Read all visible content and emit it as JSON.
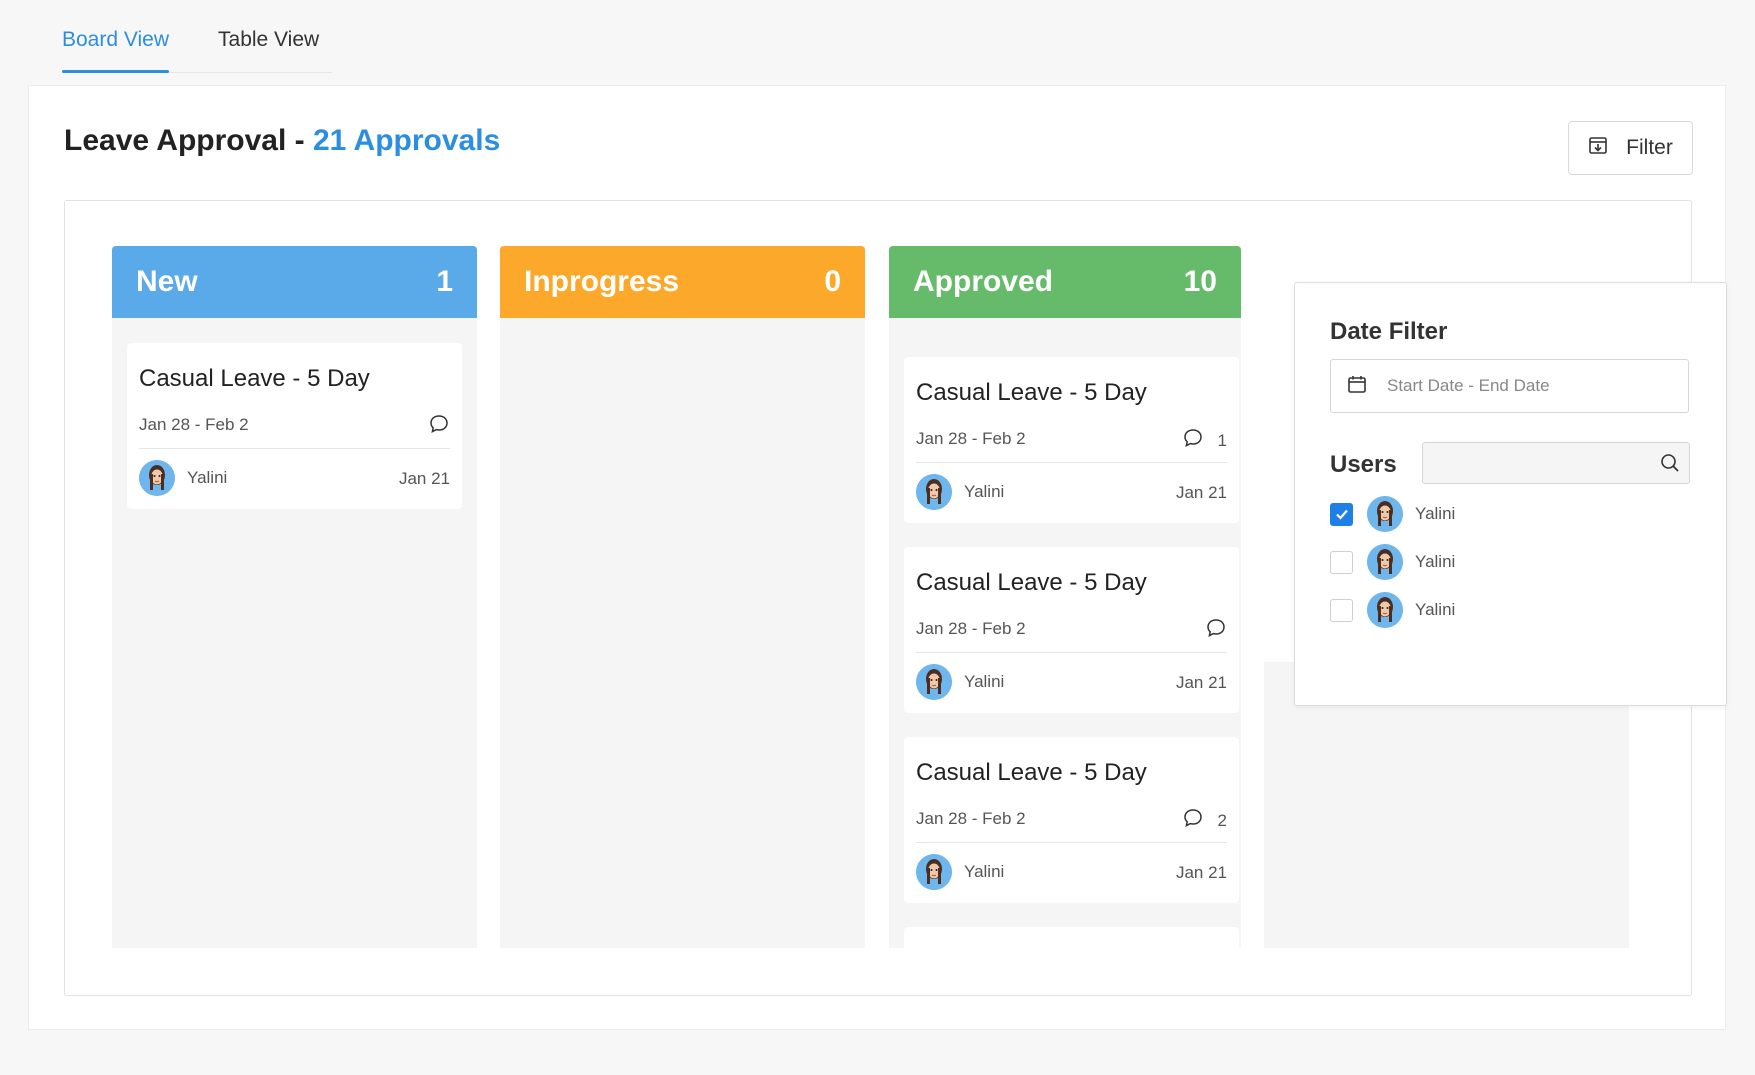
{
  "tabs": [
    {
      "label": "Board View",
      "active": true
    },
    {
      "label": "Table View",
      "active": false
    }
  ],
  "header": {
    "title": "Leave Approval - ",
    "approvals": "21 Approvals",
    "filter_label": "Filter"
  },
  "columns": [
    {
      "name": "New",
      "count": "1",
      "color": "#5aa9e8",
      "cards": [
        {
          "title": "Casual Leave - 5 Day",
          "dates": "Jan 28 - Feb 2",
          "comments": "",
          "user": "Yalini",
          "day": "Jan 21"
        }
      ]
    },
    {
      "name": "Inprogress",
      "count": "0",
      "color": "#fca92b",
      "cards": []
    },
    {
      "name": "Approved",
      "count": "10",
      "color": "#66bb6a",
      "cards": [
        {
          "title": "Casual Leave - 5 Day",
          "dates": "Jan 28 - Feb 2",
          "comments": "1",
          "user": "Yalini",
          "day": "Jan 21"
        },
        {
          "title": "Casual Leave - 5 Day",
          "dates": "Jan 28 - Feb 2",
          "comments": "",
          "user": "Yalini",
          "day": "Jan 21"
        },
        {
          "title": "Casual Leave - 5 Day",
          "dates": "Jan 28 - Feb 2",
          "comments": "2",
          "user": "Yalini",
          "day": "Jan 21"
        }
      ]
    }
  ],
  "filter_panel": {
    "date_title": "Date Filter",
    "date_placeholder": "Start Date - End Date",
    "users_title": "Users",
    "users": [
      {
        "name": "Yalini",
        "checked": true
      },
      {
        "name": "Yalini",
        "checked": false
      },
      {
        "name": "Yalini",
        "checked": false
      }
    ]
  }
}
